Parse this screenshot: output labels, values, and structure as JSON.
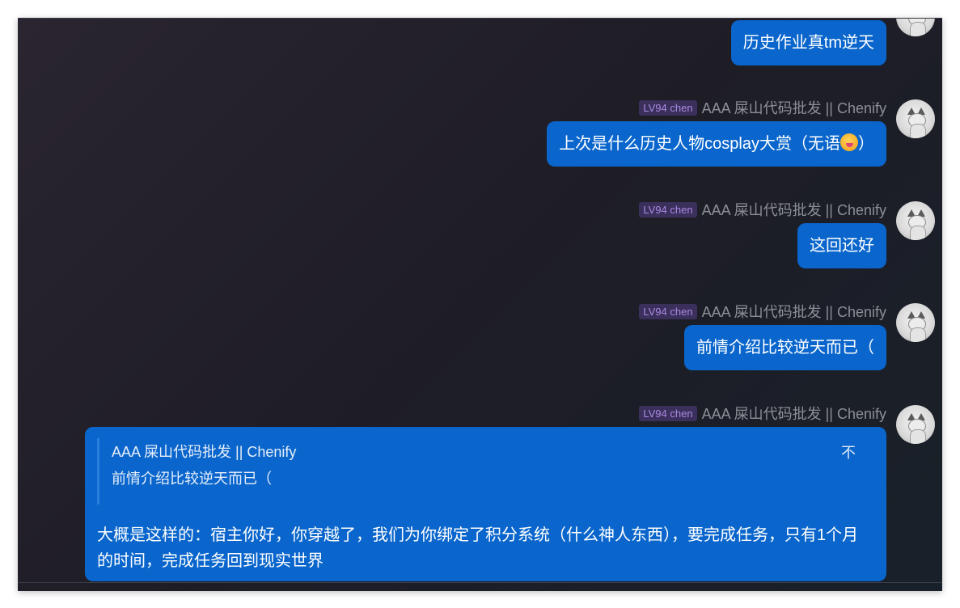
{
  "messages": [
    {
      "text": "历史作业真tm逆天",
      "show_sender": false
    },
    {
      "level": "LV94 chen",
      "sender": "AAA 屎山代码批发 || Chenify",
      "text_before": "上次是什么历史人物cosplay大赏（无语",
      "emoji": "face-with-tongue-emoji",
      "text_after": "）"
    },
    {
      "level": "LV94 chen",
      "sender": "AAA 屎山代码批发 || Chenify",
      "text": "这回还好"
    },
    {
      "level": "LV94 chen",
      "sender": "AAA 屎山代码批发 || Chenify",
      "text": "前情介绍比较逆天而已（"
    },
    {
      "level": "LV94 chen",
      "sender": "AAA 屎山代码批发 || Chenify",
      "quote": {
        "author": "AAA 屎山代码批发 || Chenify",
        "text": "前情介绍比较逆天而已（",
        "jump_icon": "不"
      },
      "text": "大概是这样的：宿主你好，你穿越了，我们为你绑定了积分系统（什么神人东西），要完成任务，只有1个月的时间，完成任务回到现实世界"
    }
  ],
  "colors": {
    "bubble": "#0a66cc",
    "badge_bg": "#3b2f5c",
    "badge_text": "#a98ae0",
    "sender_text": "#8d8f97"
  }
}
